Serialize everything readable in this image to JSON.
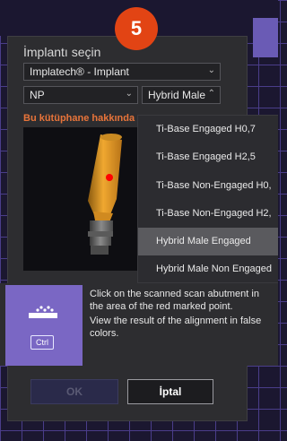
{
  "step": {
    "number": "5"
  },
  "dialog": {
    "title": "İmplantı seçin",
    "library_select": "Implatech® - Implant",
    "size_select": "NP",
    "type_select": "Hybrid Male",
    "library_link": "Bu kütüphane hakkında"
  },
  "dropdown": {
    "items": [
      "Ti-Base Engaged H0,7",
      "Ti-Base Engaged H2,5",
      "Ti-Base Non-Engaged H0,",
      "Ti-Base Non-Engaged H2,",
      "Hybrid Male Engaged",
      "Hybrid Male Non Engaged"
    ],
    "selected": "Hybrid Male Engaged"
  },
  "hint": {
    "key_label": "Ctrl",
    "line1": "Click on the scanned scan abutment in the area of the red marked point.",
    "line2": "View the result of the alignment in false colors."
  },
  "buttons": {
    "ok": "OK",
    "cancel": "İptal"
  },
  "icons": {
    "chevron": "chevron-down-icon",
    "scan": "scan-surface-icon"
  },
  "colors": {
    "badge": "#e24414",
    "link": "#e8743a",
    "accent": "#7a67c4",
    "marker": "#ff0000",
    "abutment": "#e89a2a"
  }
}
